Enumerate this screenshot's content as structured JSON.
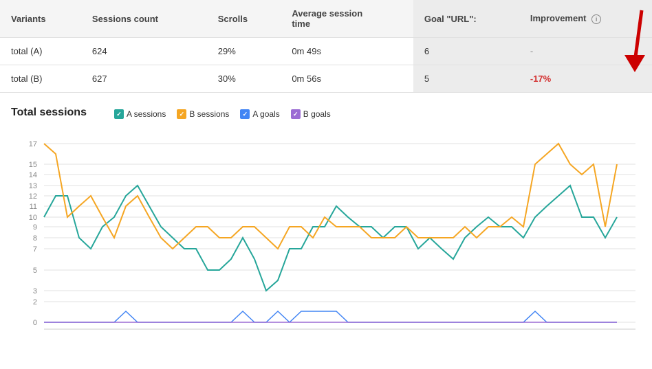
{
  "table": {
    "headers": [
      "Variants",
      "Sessions count",
      "Scrolls",
      "Average session time",
      "Goal \"URL\":",
      "Improvement"
    ],
    "rows": [
      {
        "variant": "total (A)",
        "sessions": "624",
        "scrolls": "29%",
        "avg_time": "0m 49s",
        "goal": "6",
        "improvement": "-",
        "improvement_type": "dash"
      },
      {
        "variant": "total (B)",
        "sessions": "627",
        "scrolls": "30%",
        "avg_time": "0m 56s",
        "goal": "5",
        "improvement": "-17%",
        "improvement_type": "negative"
      }
    ]
  },
  "chart": {
    "title": "Total sessions",
    "legend": [
      {
        "label": "A sessions",
        "color": "#26a69a",
        "type": "check"
      },
      {
        "label": "B sessions",
        "color": "#f5a623",
        "type": "check"
      },
      {
        "label": "A goals",
        "color": "#4285f4",
        "type": "check"
      },
      {
        "label": "B goals",
        "color": "#9c6cd4",
        "type": "check"
      }
    ],
    "y_axis_labels": [
      "0",
      "2",
      "3",
      "5",
      "7",
      "8",
      "9",
      "10",
      "11",
      "12",
      "13",
      "14",
      "15",
      "17"
    ],
    "y_ticks": [
      0,
      2,
      3,
      5,
      7,
      8,
      9,
      10,
      11,
      12,
      13,
      14,
      15,
      17
    ]
  },
  "info_icon_label": "i"
}
